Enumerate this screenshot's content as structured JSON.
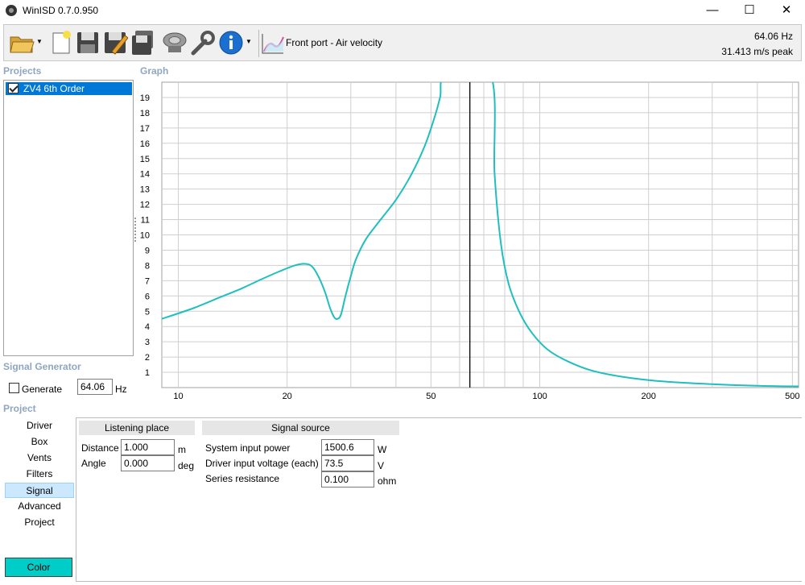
{
  "window": {
    "title": "WinISD 0.7.0.950",
    "minimize": "—",
    "maximize": "☐",
    "close": "✕"
  },
  "toolbar": {
    "icons": [
      "open-folder-icon",
      "new-project-icon",
      "save-icon",
      "edit-icon",
      "save-all-icon",
      "driver-icon",
      "tools-icon",
      "info-icon",
      "graph-type-icon"
    ],
    "graph_selection": "Front port - Air velocity",
    "frequency_readout": "64.06 Hz",
    "value_readout": "31.413 m/s peak"
  },
  "sections": {
    "projects": "Projects",
    "graph": "Graph",
    "signal_generator": "Signal Generator",
    "project": "Project"
  },
  "projects": [
    {
      "name": "ZV4 6th Order",
      "checked": true,
      "selected": true
    }
  ],
  "signal_generator": {
    "generate_label": "Generate",
    "generate_checked": false,
    "frequency": "64.06",
    "unit": "Hz"
  },
  "project_nav": {
    "items": [
      "Driver",
      "Box",
      "Vents",
      "Filters",
      "Signal",
      "Advanced",
      "Project"
    ],
    "selected": "Signal",
    "color_button": "Color"
  },
  "signal_panel": {
    "listening_place": {
      "header": "Listening place",
      "fields": [
        {
          "label": "Distance",
          "value": "1.000",
          "unit": "m"
        },
        {
          "label": "Angle",
          "value": "0.000",
          "unit": "deg"
        }
      ]
    },
    "signal_source": {
      "header": "Signal source",
      "fields": [
        {
          "label": "System input power",
          "value": "1500.6",
          "unit": "W"
        },
        {
          "label": "Driver input voltage (each)",
          "value": "73.5",
          "unit": "V"
        },
        {
          "label": "Series resistance",
          "value": "0.100",
          "unit": "ohm"
        }
      ]
    }
  },
  "colors": {
    "curve": "#1fbfbf",
    "selection": "#0078d7",
    "color_button": "#00cdc8",
    "section_label": "#8fa6c1"
  },
  "chart_data": {
    "type": "line",
    "x_scale": "log",
    "xlim": [
      9,
      520
    ],
    "ylim": [
      0,
      20
    ],
    "x_tick_labels": [
      10,
      20,
      50,
      100,
      200,
      500
    ],
    "y_tick_labels": [
      1,
      2,
      3,
      4,
      5,
      6,
      7,
      8,
      9,
      10,
      11,
      12,
      13,
      14,
      15,
      16,
      17,
      18,
      19
    ],
    "grid": true,
    "cursor_x": 64.06,
    "series": [
      {
        "x": [
          9,
          11,
          13,
          15,
          17,
          19,
          21,
          22.5,
          23.5,
          24.5,
          25.5,
          26.3,
          27,
          27.6,
          28.2,
          29,
          30,
          31,
          33,
          36,
          40,
          44,
          48,
          51,
          53,
          55,
          73,
          75,
          78,
          82,
          88,
          95,
          105,
          120,
          140,
          170,
          220,
          300,
          400,
          520
        ],
        "y": [
          4.5,
          5.2,
          5.9,
          6.5,
          7.1,
          7.6,
          8.0,
          8.1,
          7.9,
          7.2,
          6.2,
          5.2,
          4.6,
          4.5,
          4.8,
          6.0,
          7.3,
          8.4,
          9.7,
          10.9,
          12.3,
          13.9,
          15.8,
          17.6,
          19.0,
          20.5,
          20.5,
          14.0,
          9.5,
          6.8,
          4.9,
          3.6,
          2.5,
          1.7,
          1.1,
          0.7,
          0.4,
          0.22,
          0.12,
          0.08
        ]
      }
    ]
  }
}
